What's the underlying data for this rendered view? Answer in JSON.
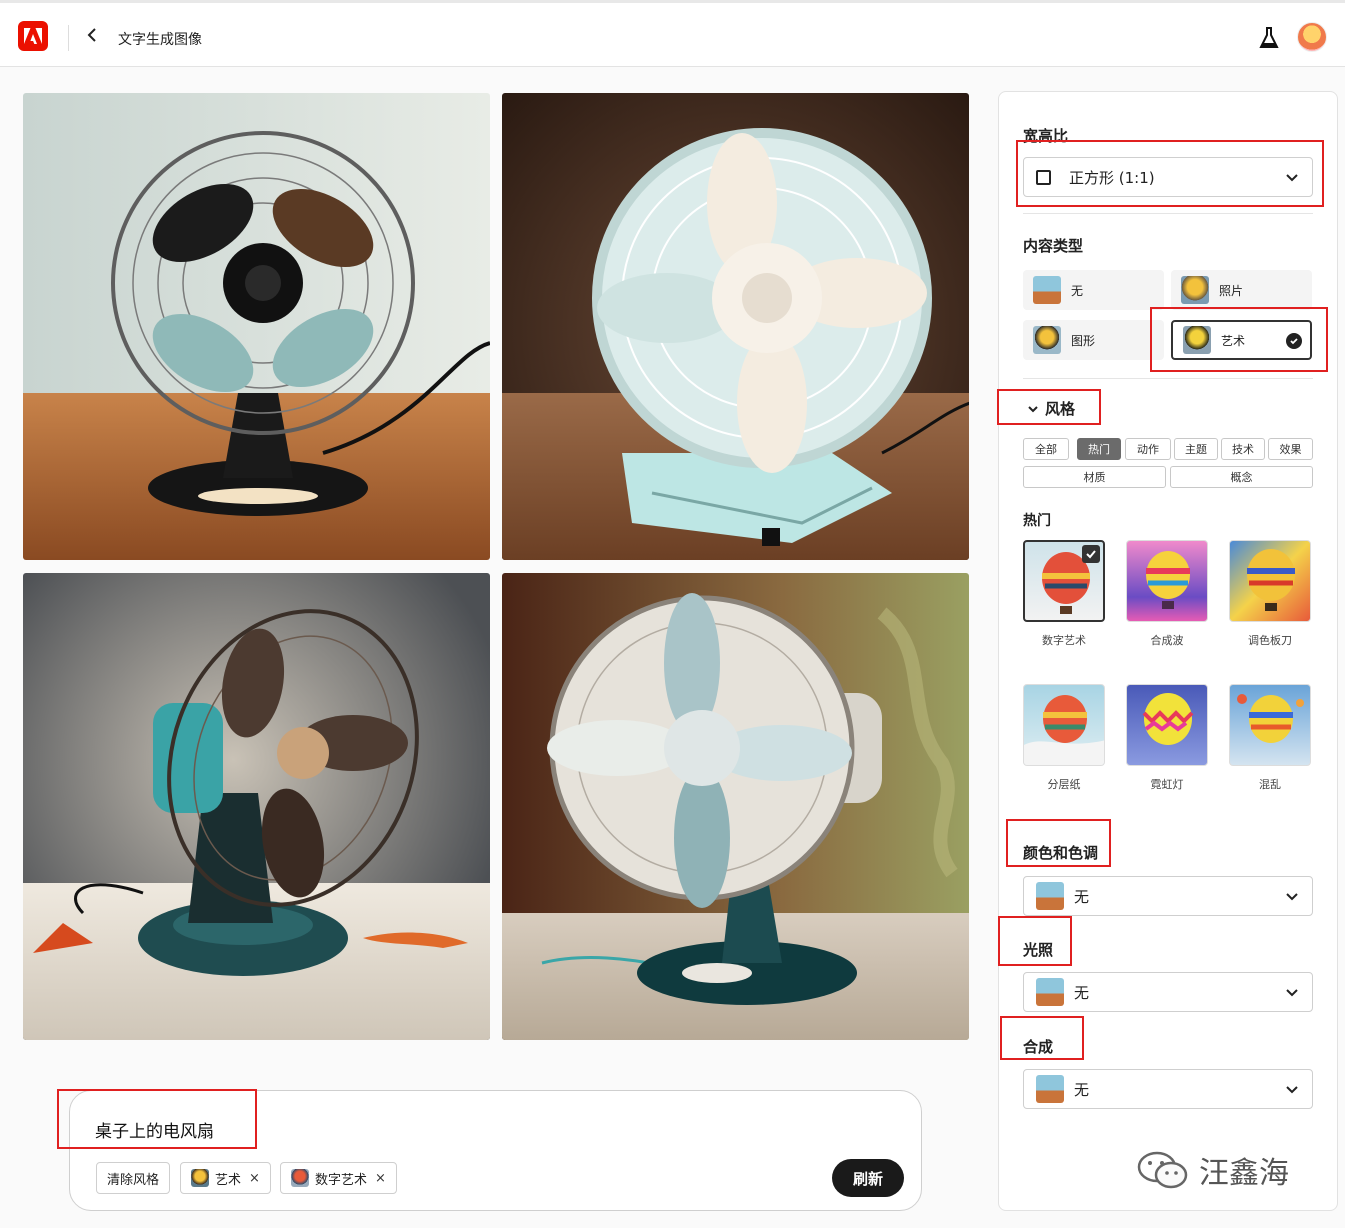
{
  "topbar": {
    "title": "文字生成图像",
    "back_icon": "chevron-left-icon",
    "logo_icon": "adobe-logo-icon",
    "labs_icon": "flask-icon"
  },
  "prompt": {
    "text": "桌子上的电风扇",
    "clear_label": "清除风格",
    "chips": [
      {
        "label": "艺术"
      },
      {
        "label": "数字艺术"
      }
    ],
    "refresh_label": "刷新"
  },
  "panel": {
    "aspect": {
      "heading": "宽高比",
      "value": "正方形 (1:1)"
    },
    "content_type": {
      "heading": "内容类型",
      "options": [
        {
          "label": "无"
        },
        {
          "label": "照片"
        },
        {
          "label": "图形"
        },
        {
          "label": "艺术"
        }
      ],
      "selected": "艺术"
    },
    "style": {
      "heading": "风格",
      "tabs": [
        "全部",
        "热门",
        "动作",
        "主题",
        "技术",
        "效果",
        "材质",
        "概念"
      ],
      "active_tab": "热门",
      "section_title": "热门",
      "cards": [
        "数字艺术",
        "合成波",
        "调色板刀",
        "分层纸",
        "霓虹灯",
        "混乱"
      ],
      "selected": "数字艺术"
    },
    "color_tone": {
      "heading": "颜色和色调",
      "value": "无"
    },
    "lighting": {
      "heading": "光照",
      "value": "无"
    },
    "composition": {
      "heading": "合成",
      "value": "无"
    }
  },
  "watermark": {
    "text": "汪鑫海"
  },
  "colors": {
    "accent_red": "#e02020",
    "adobe_red": "#eb1000",
    "dark_button": "#1a1a1a"
  }
}
